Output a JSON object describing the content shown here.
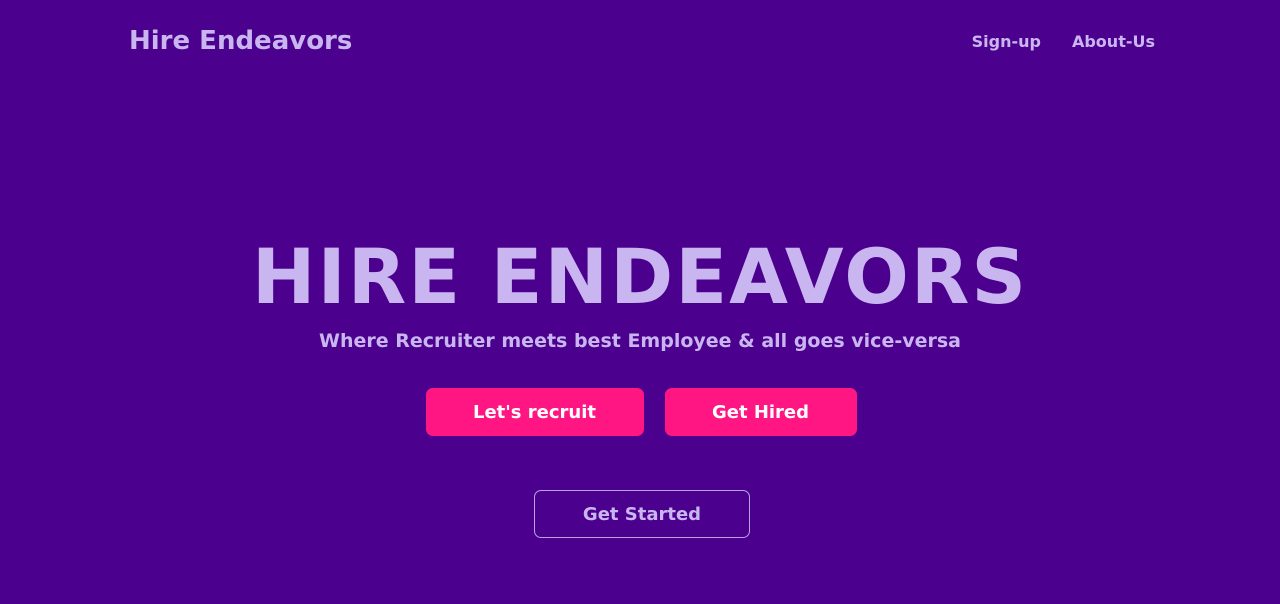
{
  "header": {
    "brand": "Hire Endeavors",
    "nav": {
      "signup": "Sign-up",
      "about": "About-Us"
    }
  },
  "hero": {
    "title": "HIRE ENDEAVORS",
    "subtitle": "Where Recruiter meets best Employee & all goes vice-versa"
  },
  "actions": {
    "recruit_label": "Let's recruit",
    "hired_label": "Get Hired",
    "get_started_label": "Get Started"
  },
  "colors": {
    "background": "#4b008e",
    "text": "#c9b6f0",
    "accent": "#ff1683"
  }
}
